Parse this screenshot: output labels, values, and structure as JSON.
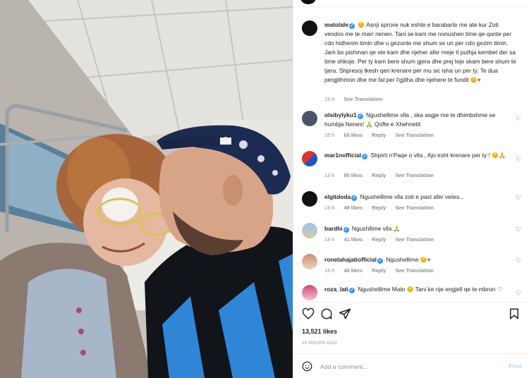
{
  "post": {
    "caption": {
      "username": "matolale",
      "text": "Asnji sprove nuk eshte e barabarte me ate kur Zoti vendos me te marr nenen. Tani se kam me nonushen time qe qante per cdo hidherim timin dhe u gezonte me shum se un per cdo gezim timin. Jam bo pishman qe ste kam dhe njeher afer meje ti puthja kembet der sa time shkoje. Per ty kam bere shum gjera dhe prej teje skam bere shum te tjera. Shpresoj tkesh qen krenare per mu sic isha un per ty. Te dua pergjithmon dhe me fal per t'gjitha dhe njehere te fundit",
      "time": "15 h",
      "see_translation": "See Translation"
    },
    "comments": [
      {
        "username": "olsibylyku1",
        "text": "Ngushellime vlla , ska asgje me te dhimbshme se humbja Nenes!",
        "text2": "Qofte e Xhehnetit",
        "time": "15 h",
        "likes": "65 likes",
        "reply": "Reply",
        "see_translation": "See Translation"
      },
      {
        "username": "mar1nofficial",
        "text": "Shpirti n'Paqe o vlla , Ajo esht krenare per ty !",
        "time": "13 h",
        "likes": "50 likes",
        "reply": "Reply",
        "see_translation": "See Translation"
      },
      {
        "username": "elgitdoda",
        "text": "Ngushellime vlla zoti e past afer vetes...",
        "time": "15 h",
        "likes": "49 likes",
        "reply": "Reply",
        "see_translation": "See Translation"
      },
      {
        "username": "bardhi",
        "text": "Ngushllime vlla.",
        "time": "14 h",
        "likes": "41 likes",
        "reply": "Reply",
        "see_translation": "See Translation"
      },
      {
        "username": "ronelahajatiofficial",
        "text": "Ngushellime",
        "time": "15 h",
        "likes": "46 likes",
        "reply": "Reply",
        "see_translation": "See Translation"
      },
      {
        "username": "roza_lati",
        "text": "Ngushellime Mato",
        "text2": "Tani ke nje engjell qe te mbron"
      }
    ],
    "likes_count": "13,521 likes",
    "posted_ago": "15 HOURS AGO",
    "add_comment_placeholder": "Add a comment...",
    "post_button": "Post"
  },
  "icons": {
    "like": "heart-outline-icon",
    "comment": "comment-bubble-icon",
    "share": "paper-plane-icon",
    "save": "bookmark-icon",
    "emoji": "smiley-icon",
    "verified": "verified-badge-icon"
  },
  "colors": {
    "verified": "#3897f0",
    "link_muted": "#8e8e8e",
    "post_button_disabled": "#b3dbff",
    "heart_red": "#ed4956"
  }
}
